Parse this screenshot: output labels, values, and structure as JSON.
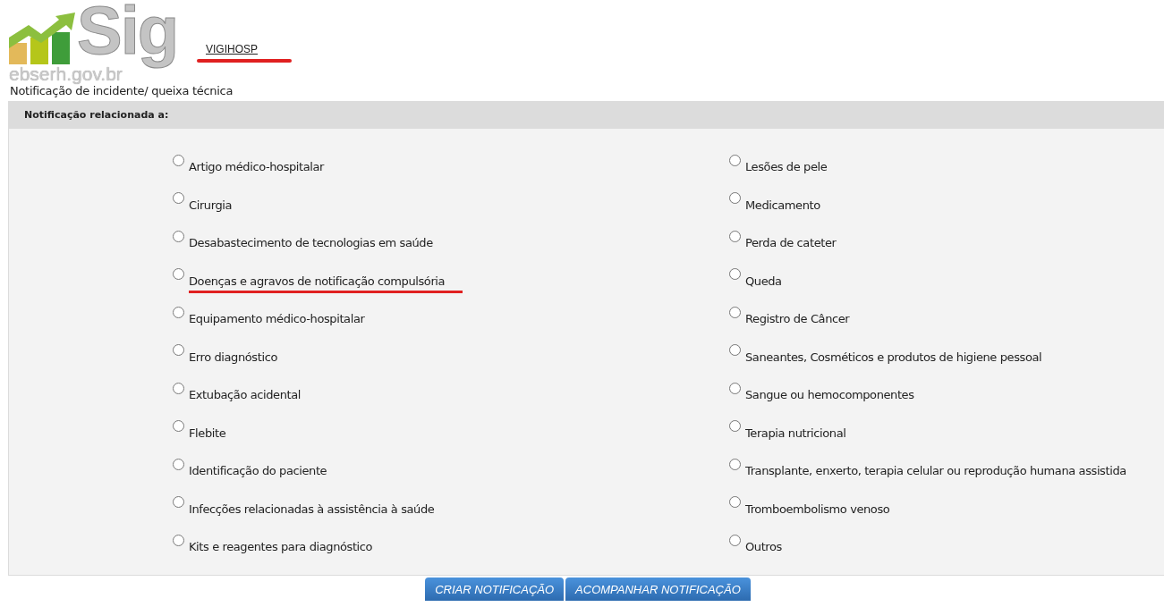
{
  "logo": {
    "wordmark": "Sig",
    "domain": "ebserh.gov.br"
  },
  "system_link": {
    "label": "VIGIHOSP",
    "underlined": true
  },
  "page_title": "Notificação de incidente/ queixa técnica",
  "panel": {
    "heading": "Notificação relacionada a:",
    "options": [
      {
        "label": "Artigo médico-hospitalar",
        "selected": false,
        "underlined": false
      },
      {
        "label": "Cirurgia",
        "selected": false,
        "underlined": false
      },
      {
        "label": "Desabastecimento de tecnologias em saúde",
        "selected": false,
        "underlined": false
      },
      {
        "label": "Doenças e agravos de notificação compulsória",
        "selected": false,
        "underlined": true
      },
      {
        "label": "Equipamento médico-hospitalar",
        "selected": false,
        "underlined": false
      },
      {
        "label": "Erro diagnóstico",
        "selected": false,
        "underlined": false
      },
      {
        "label": "Extubação acidental",
        "selected": false,
        "underlined": false
      },
      {
        "label": "Flebite",
        "selected": false,
        "underlined": false
      },
      {
        "label": "Identificação do paciente",
        "selected": false,
        "underlined": false
      },
      {
        "label": "Infecções relacionadas à assistência à saúde",
        "selected": false,
        "underlined": false
      },
      {
        "label": "Kits e reagentes para diagnóstico",
        "selected": false,
        "underlined": false
      },
      {
        "label": "Lesões de pele",
        "selected": false,
        "underlined": false
      },
      {
        "label": "Medicamento",
        "selected": false,
        "underlined": false
      },
      {
        "label": "Perda de cateter",
        "selected": false,
        "underlined": false
      },
      {
        "label": "Queda",
        "selected": false,
        "underlined": false
      },
      {
        "label": "Registro de Câncer",
        "selected": false,
        "underlined": false
      },
      {
        "label": "Saneantes, Cosméticos e produtos de higiene pessoal",
        "selected": false,
        "underlined": false
      },
      {
        "label": "Sangue ou hemocomponentes",
        "selected": false,
        "underlined": false
      },
      {
        "label": "Terapia nutricional",
        "selected": false,
        "underlined": false
      },
      {
        "label": "Transplante, enxerto, terapia celular ou reprodução humana assistida",
        "selected": false,
        "underlined": false
      },
      {
        "label": "Tromboembolismo venoso",
        "selected": false,
        "underlined": false
      },
      {
        "label": "Outros",
        "selected": false,
        "underlined": false
      }
    ]
  },
  "buttons": [
    "CRIAR NOTIFICAÇÃO",
    "ACOMPANHAR NOTIFICAÇÃO"
  ]
}
